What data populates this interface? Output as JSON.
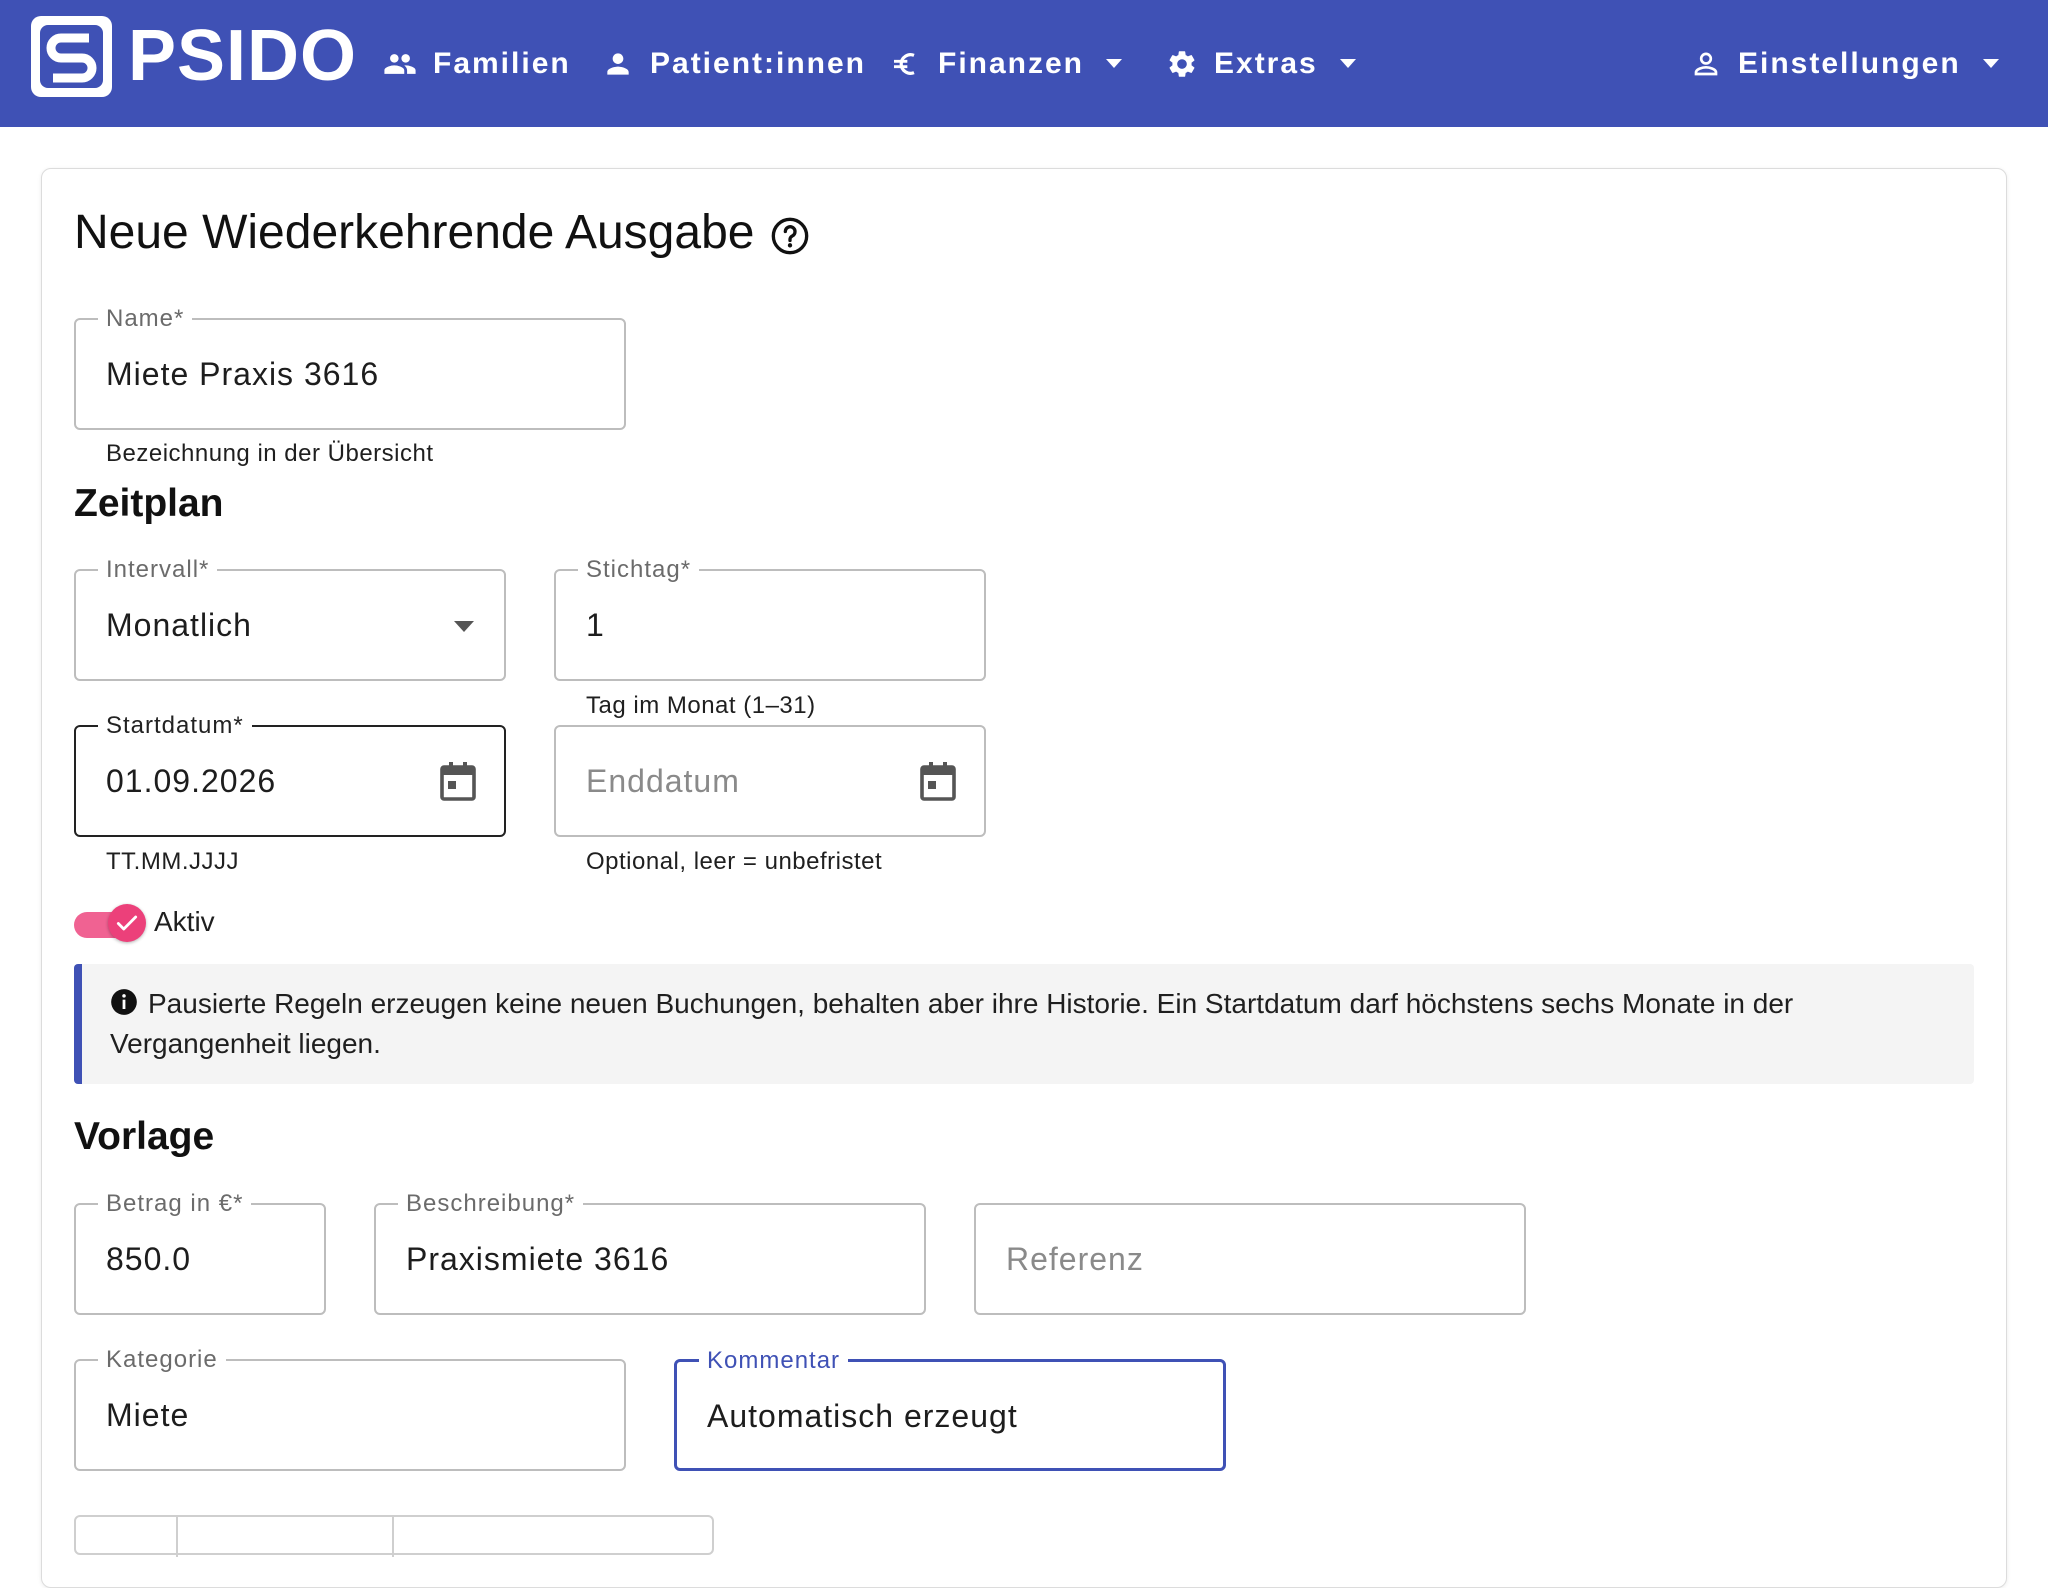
{
  "navbar": {
    "brand": "PSIDO",
    "items": [
      {
        "label": "Familien",
        "icon": "people-icon",
        "dropdown": false
      },
      {
        "label": "Patient:innen",
        "icon": "person-icon",
        "dropdown": false
      },
      {
        "label": "Finanzen",
        "icon": "euro-icon",
        "dropdown": true
      },
      {
        "label": "Extras",
        "icon": "gear-icon",
        "dropdown": true
      },
      {
        "label": "Einstellungen",
        "icon": "person-outline-icon",
        "dropdown": true
      }
    ],
    "color": "#3f51b5"
  },
  "page": {
    "title": "Neue Wiederkehrende Ausgabe"
  },
  "form": {
    "name": {
      "label": "Name*",
      "value": "Miete Praxis 3616",
      "hint": "Bezeichnung in der Übersicht"
    },
    "schedule_heading": "Zeitplan",
    "interval": {
      "label": "Intervall*",
      "value": "Monatlich"
    },
    "stichtag": {
      "label": "Stichtag*",
      "value": "1",
      "hint": "Tag im Monat (1–31)"
    },
    "startdatum": {
      "label": "Startdatum*",
      "value": "01.09.2026",
      "hint": "TT.MM.JJJJ"
    },
    "enddatum": {
      "placeholder": "Enddatum",
      "hint": "Optional, leer = unbefristet"
    },
    "active": {
      "label": "Aktiv",
      "checked": true,
      "color": "#ec407a"
    },
    "info": "Pausierte Regeln erzeugen keine neuen Buchungen, behalten aber ihre Historie. Ein Startdatum darf höchstens sechs Monate in der Vergangenheit liegen.",
    "template_heading": "Vorlage",
    "betrag": {
      "label": "Betrag in €*",
      "value": "850.0"
    },
    "beschreibung": {
      "label": "Beschreibung*",
      "value": "Praxismiete 3616"
    },
    "referenz": {
      "placeholder": "Referenz"
    },
    "kategorie": {
      "label": "Kategorie",
      "value": "Miete"
    },
    "kommentar": {
      "label": "Kommentar",
      "value": "Automatisch erzeugt"
    }
  }
}
